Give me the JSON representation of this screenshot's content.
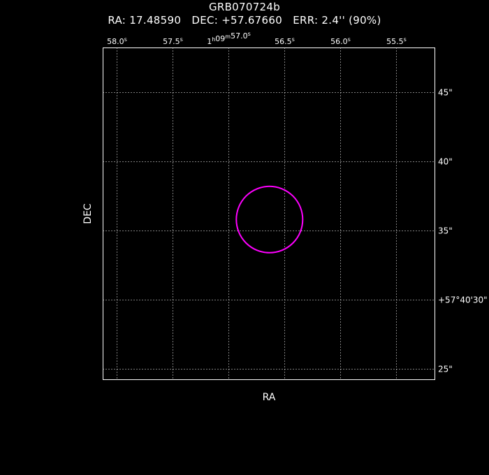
{
  "header": {
    "title": "GRB070724b",
    "info": "RA: 17.48590   DEC: +57.67660   ERR: 2.4'' (90%)"
  },
  "colors": {
    "background": "#000000",
    "frame": "#ffffff",
    "grid": "#ffffff",
    "error_circle": "#ff00ff"
  },
  "chart_data": {
    "type": "scatter",
    "title": "GRB070724b",
    "xlabel": "RA",
    "ylabel": "DEC",
    "x_axis": {
      "unit": "seconds of RA (1h09m)",
      "range": [
        58.12,
        55.15
      ],
      "ticks": [
        {
          "value": 58.0,
          "label": "58.0",
          "sup": "s"
        },
        {
          "value": 57.5,
          "label": "57.5",
          "sup": "s"
        },
        {
          "value": 57.0,
          "label": "1h09m57.0",
          "sup": "s"
        },
        {
          "value": 56.5,
          "label": "56.5",
          "sup": "s"
        },
        {
          "value": 56.0,
          "label": "56.0",
          "sup": "s"
        },
        {
          "value": 55.5,
          "label": "55.5",
          "sup": "s"
        }
      ]
    },
    "y_axis": {
      "unit": "arcsec of DEC (+57°40')",
      "range": [
        24.2,
        48.2
      ],
      "ticks": [
        {
          "value": 45,
          "label": "45\""
        },
        {
          "value": 40,
          "label": "40\""
        },
        {
          "value": 35,
          "label": "35\""
        },
        {
          "value": 30,
          "label": "+57°40'30\""
        },
        {
          "value": 25,
          "label": "25\""
        }
      ]
    },
    "grid": true,
    "grid_style": "dotted",
    "error_circle": {
      "ra": 17.4859,
      "dec": 57.6766,
      "ra_s": 56.63,
      "dec_arcsec": 35.78,
      "radius_arcsec": 2.4,
      "confidence": "90%"
    }
  }
}
